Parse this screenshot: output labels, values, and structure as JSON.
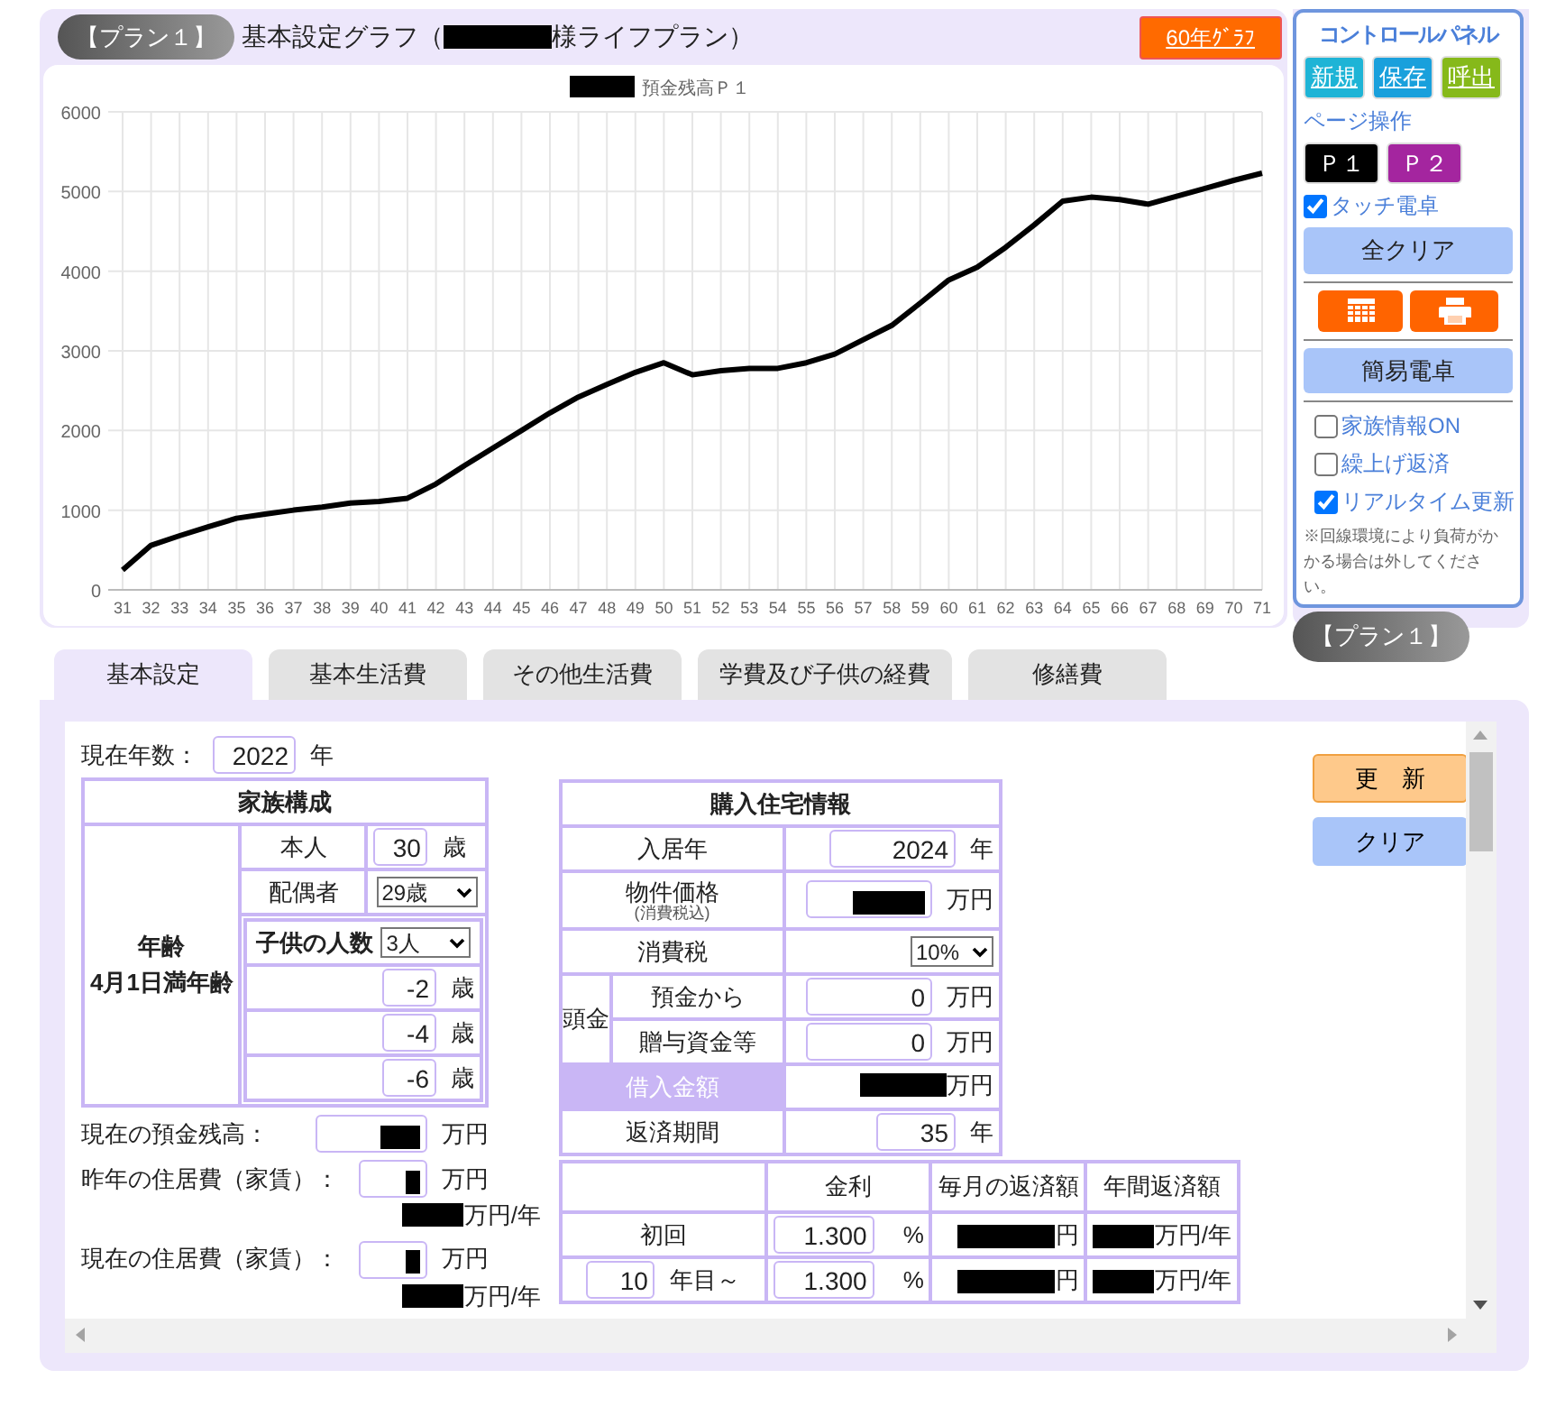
{
  "plan_badge": "【プラン１】",
  "graph_title": {
    "prefix": "基本設定グラフ（",
    "suffix": "様ライフプラン）"
  },
  "graph_button": "60年ｸﾞﾗﾌ",
  "chart": {
    "chart_data": {
      "type": "line",
      "categories": [
        "31",
        "32",
        "33",
        "34",
        "35",
        "36",
        "37",
        "38",
        "39",
        "40",
        "41",
        "42",
        "43",
        "44",
        "45",
        "46",
        "47",
        "48",
        "49",
        "50",
        "51",
        "52",
        "53",
        "54",
        "55",
        "56",
        "57",
        "58",
        "59",
        "60",
        "61",
        "62",
        "63",
        "64",
        "65",
        "66",
        "67",
        "68",
        "69",
        "70",
        "71"
      ],
      "series": [
        {
          "name": "預金残高Ｐ１",
          "color": "#000000",
          "values": [
            250,
            560,
            680,
            790,
            900,
            950,
            1000,
            1040,
            1090,
            1110,
            1150,
            1330,
            1560,
            1780,
            2000,
            2220,
            2420,
            2580,
            2730,
            2850,
            2700,
            2750,
            2780,
            2780,
            2850,
            2960,
            3140,
            3320,
            3600,
            3890,
            4050,
            4300,
            4580,
            4880,
            4930,
            4900,
            4840,
            4940,
            5040,
            5140,
            5230
          ]
        }
      ],
      "ylim": [
        0,
        6000
      ],
      "grid": true,
      "yticks": [
        0,
        1000,
        2000,
        3000,
        4000,
        5000,
        6000
      ]
    }
  },
  "control_panel": {
    "title": "コントロールパネル",
    "file_buttons": [
      {
        "label": "新規",
        "color": "#1eb4d6"
      },
      {
        "label": "保存",
        "color": "#19a0dc"
      },
      {
        "label": "呼出",
        "color": "#86b91a"
      }
    ],
    "page_label": "ページ操作",
    "page_buttons": [
      {
        "label": "Ｐ１",
        "color": "#000000"
      },
      {
        "label": "Ｐ２",
        "color": "#a4259f"
      }
    ],
    "touch_calc": {
      "label": "タッチ電卓",
      "checked": true
    },
    "clear_all": "全クリア",
    "simple_calc": "簡易電卓",
    "options": [
      {
        "label": "家族情報ON",
        "checked": false
      },
      {
        "label": "繰上げ返済",
        "checked": false
      },
      {
        "label": "リアルタイム更新",
        "checked": true
      }
    ],
    "note": "※回線環境により負荷がかかる場合は外してください。"
  },
  "plan_badge_bottom": "【プラン１】",
  "tabs": [
    {
      "label": "基本設定",
      "selected": true
    },
    {
      "label": "基本生活費",
      "selected": false
    },
    {
      "label": "その他生活費",
      "selected": false
    },
    {
      "label": "学費及び子供の経費",
      "selected": false
    },
    {
      "label": "修繕費",
      "selected": false
    }
  ],
  "form": {
    "current_year": {
      "label": "現在年数：",
      "value": "2022",
      "unit": "年"
    },
    "family": {
      "title": "家族構成",
      "row_label": "年齢",
      "row_sublabel": "4月1日満年齢",
      "self": {
        "label": "本人",
        "value": "30",
        "unit": "歳"
      },
      "spouse": {
        "label": "配偶者",
        "value": "29歳"
      },
      "children_count": {
        "label": "子供の人数",
        "value": "3人"
      },
      "children": [
        {
          "value": "-2",
          "unit": "歳"
        },
        {
          "value": "-4",
          "unit": "歳"
        },
        {
          "value": "-6",
          "unit": "歳"
        }
      ]
    },
    "savings": {
      "label": "現在の預金残高：",
      "unit": "万円",
      "redacted": true
    },
    "last_year_housing": {
      "label": "昨年の住居費（家賃）：",
      "unit": "万円",
      "annual_unit": "万円/年",
      "redacted": true
    },
    "current_housing": {
      "label": "現在の住居費（家賃）：",
      "unit": "万円",
      "annual_unit": "万円/年",
      "redacted": true
    },
    "housing": {
      "title": "購入住宅情報",
      "rows": [
        {
          "kind": "input",
          "label": "入居年",
          "value": "2024",
          "unit": "年"
        },
        {
          "kind": "input",
          "label": "物件価格",
          "sublabel": "(消費税込)",
          "unit": "万円",
          "redacted": true
        },
        {
          "kind": "select",
          "label": "消費税",
          "value": "10%"
        },
        {
          "kind": "group",
          "group_label": "頭金",
          "items": [
            {
              "label": "預金から",
              "value": "0",
              "unit": "万円"
            },
            {
              "label": "贈与資金等",
              "value": "0",
              "unit": "万円"
            }
          ]
        },
        {
          "kind": "result",
          "label": "借入金額",
          "unit": "万円",
          "redacted": true
        },
        {
          "kind": "input",
          "label": "返済期間",
          "value": "35",
          "unit": "年"
        }
      ]
    },
    "loan": {
      "columns": [
        "金利",
        "毎月の返済額",
        "年間返済額"
      ],
      "rows": [
        {
          "kind": "first",
          "label": "初回",
          "rate": "1.300",
          "rate_unit": "%",
          "monthly": "円",
          "annual": "万円/年",
          "redacted": true
        },
        {
          "kind": "from",
          "from": "10",
          "label": "年目～",
          "rate": "1.300",
          "rate_unit": "%",
          "monthly": "円",
          "annual": "万円/年",
          "redacted": true
        }
      ]
    },
    "buttons": [
      {
        "label": "更　新",
        "kind": "update"
      },
      {
        "label": "クリア",
        "kind": "clear"
      }
    ]
  }
}
